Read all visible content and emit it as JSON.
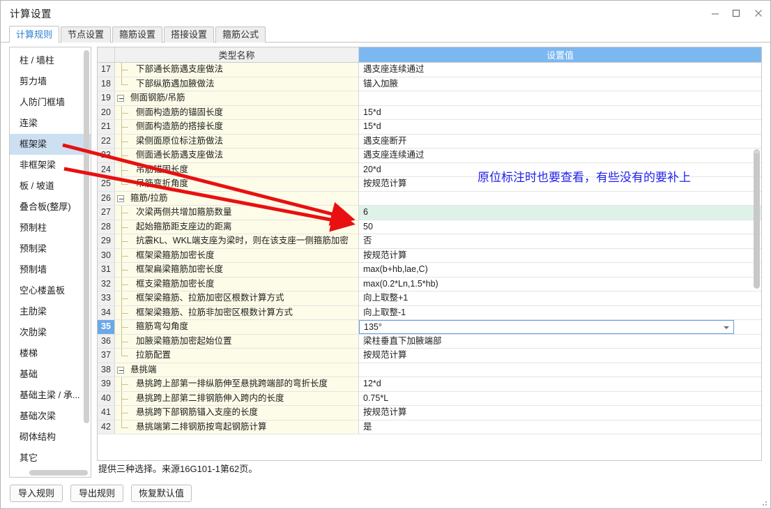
{
  "window": {
    "title": "计算设置",
    "minimize_icon": "minimize-icon",
    "maximize_icon": "maximize-icon",
    "close_icon": "close-icon"
  },
  "tabs": [
    {
      "label": "计算规则",
      "active": true
    },
    {
      "label": "节点设置",
      "active": false
    },
    {
      "label": "箍筋设置",
      "active": false
    },
    {
      "label": "搭接设置",
      "active": false
    },
    {
      "label": "箍筋公式",
      "active": false
    }
  ],
  "sidebar": {
    "items": [
      {
        "label": "柱 / 墙柱",
        "selected": false
      },
      {
        "label": "剪力墙",
        "selected": false
      },
      {
        "label": "人防门框墙",
        "selected": false
      },
      {
        "label": "连梁",
        "selected": false
      },
      {
        "label": "框架梁",
        "selected": true
      },
      {
        "label": "非框架梁",
        "selected": false
      },
      {
        "label": "板 / 坡道",
        "selected": false
      },
      {
        "label": "叠合板(整厚)",
        "selected": false
      },
      {
        "label": "预制柱",
        "selected": false
      },
      {
        "label": "预制梁",
        "selected": false
      },
      {
        "label": "预制墙",
        "selected": false
      },
      {
        "label": "空心楼盖板",
        "selected": false
      },
      {
        "label": "主肋梁",
        "selected": false
      },
      {
        "label": "次肋梁",
        "selected": false
      },
      {
        "label": "楼梯",
        "selected": false
      },
      {
        "label": "基础",
        "selected": false
      },
      {
        "label": "基础主梁 / 承...",
        "selected": false
      },
      {
        "label": "基础次梁",
        "selected": false
      },
      {
        "label": "砌体结构",
        "selected": false
      },
      {
        "label": "其它",
        "selected": false
      }
    ]
  },
  "grid": {
    "columns": [
      "",
      "类型名称",
      "设置值"
    ],
    "value_header_color": "#7cb8f0",
    "rows": [
      {
        "num": "17",
        "name": "下部通长筋遇支座做法",
        "value": "遇支座连续通过",
        "type": "leaf"
      },
      {
        "num": "18",
        "name": "下部纵筋遇加腋做法",
        "value": "锚入加腋",
        "type": "leaf",
        "last": true
      },
      {
        "num": "19",
        "name": "侧面钢筋/吊筋",
        "value": "",
        "type": "group"
      },
      {
        "num": "20",
        "name": "侧面构造筋的锚固长度",
        "value": "15*d",
        "type": "leaf"
      },
      {
        "num": "21",
        "name": "侧面构造筋的搭接长度",
        "value": "15*d",
        "type": "leaf"
      },
      {
        "num": "22",
        "name": "梁侧面原位标注筋做法",
        "value": "遇支座断开",
        "type": "leaf"
      },
      {
        "num": "23",
        "name": "侧面通长筋遇支座做法",
        "value": "遇支座连续通过",
        "type": "leaf"
      },
      {
        "num": "24",
        "name": "吊筋锚固长度",
        "value": "20*d",
        "type": "leaf"
      },
      {
        "num": "25",
        "name": "吊筋弯折角度",
        "value": "按规范计算",
        "type": "leaf",
        "last": true
      },
      {
        "num": "26",
        "name": "箍筋/拉筋",
        "value": "",
        "type": "group"
      },
      {
        "num": "27",
        "name": "次梁两侧共增加箍筋数量",
        "value": "6",
        "type": "leaf",
        "highlight": true
      },
      {
        "num": "28",
        "name": "起始箍筋距支座边的距离",
        "value": "50",
        "type": "leaf"
      },
      {
        "num": "29",
        "name": "抗震KL、WKL端支座为梁时，则在该支座一侧箍筋加密",
        "value": "否",
        "type": "leaf"
      },
      {
        "num": "30",
        "name": "框架梁箍筋加密长度",
        "value": "按规范计算",
        "type": "leaf"
      },
      {
        "num": "31",
        "name": "框架扁梁箍筋加密长度",
        "value": "max(b+hb,lae,C)",
        "type": "leaf"
      },
      {
        "num": "32",
        "name": "框支梁箍筋加密长度",
        "value": "max(0.2*Ln,1.5*hb)",
        "type": "leaf"
      },
      {
        "num": "33",
        "name": "框架梁箍筋、拉筋加密区根数计算方式",
        "value": "向上取整+1",
        "type": "leaf"
      },
      {
        "num": "34",
        "name": "框架梁箍筋、拉筋非加密区根数计算方式",
        "value": "向上取整-1",
        "type": "leaf"
      },
      {
        "num": "35",
        "name": "箍筋弯勾角度",
        "value": "135°",
        "type": "leaf",
        "selected": true,
        "editor": true
      },
      {
        "num": "36",
        "name": "加腋梁箍筋加密起始位置",
        "value": "梁柱垂直下加腋端部",
        "type": "leaf"
      },
      {
        "num": "37",
        "name": "拉筋配置",
        "value": "按规范计算",
        "type": "leaf",
        "last": true
      },
      {
        "num": "38",
        "name": "悬挑端",
        "value": "",
        "type": "group"
      },
      {
        "num": "39",
        "name": "悬挑跨上部第一排纵筋伸至悬挑跨端部的弯折长度",
        "value": "12*d",
        "type": "leaf"
      },
      {
        "num": "40",
        "name": "悬挑跨上部第二排钢筋伸入跨内的长度",
        "value": "0.75*L",
        "type": "leaf"
      },
      {
        "num": "41",
        "name": "悬挑跨下部钢筋锚入支座的长度",
        "value": "按规范计算",
        "type": "leaf"
      },
      {
        "num": "42",
        "name": "悬挑端第二排钢筋按弯起钢筋计算",
        "value": "是",
        "type": "leaf",
        "last": true
      }
    ]
  },
  "hint": "提供三种选择。来源16G101-1第62页。",
  "footer": {
    "buttons": [
      {
        "label": "导入规则"
      },
      {
        "label": "导出规则"
      },
      {
        "label": "恢复默认值"
      }
    ]
  },
  "annotation": {
    "text": "原位标注时也要查看，有些没有的要补上",
    "color": "#2222ee"
  }
}
